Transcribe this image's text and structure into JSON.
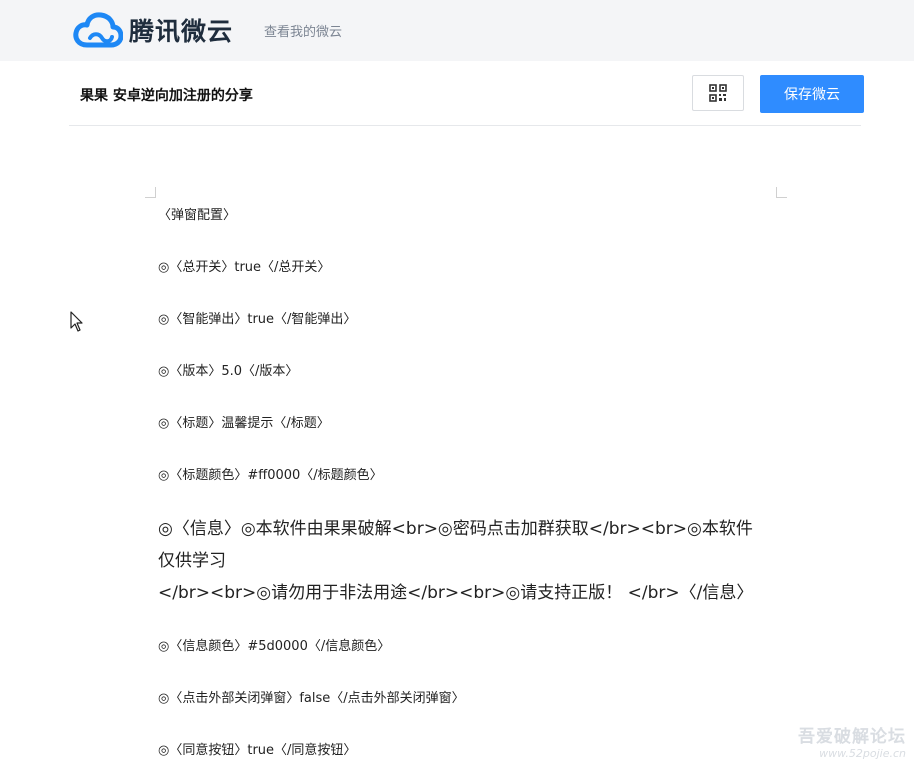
{
  "header": {
    "logo_text": "腾讯微云",
    "nav_link": "查看我的微云"
  },
  "share": {
    "title": "果果 安卓逆向加注册的分享",
    "save_button": "保存微云"
  },
  "document": {
    "lines": [
      "〈弹窗配置〉",
      "◎〈总开关〉true〈/总开关〉",
      "◎〈智能弹出〉true〈/智能弹出〉",
      "◎〈版本〉5.0〈/版本〉",
      "◎〈标题〉温馨提示〈/标题〉",
      "◎〈标题颜色〉#ff0000〈/标题颜色〉",
      "◎〈信息〉◎本软件由果果破解<br>◎密码点击加群获取</br><br>◎本软件仅供学习",
      "</br><br>◎请勿用于非法用途</br><br>◎请支持正版！ </br>〈/信息〉",
      "◎〈信息颜色〉#5d0000〈/信息颜色〉",
      "◎〈点击外部关闭弹窗〉false〈/点击外部关闭弹窗〉",
      "◎〈同意按钮〉true〈/同意按钮〉"
    ]
  },
  "watermark": {
    "line1": "吾爱破解论坛",
    "line2": "www.52pojie.cn"
  },
  "colors": {
    "topbar_bg": "#f4f5f7",
    "accent": "#2f8cff",
    "logo_blue": "#1e88f5"
  },
  "icons": {
    "logo": "cloud-logo-icon",
    "qr": "qr-code-icon",
    "cursor": "mouse-pointer-icon"
  }
}
